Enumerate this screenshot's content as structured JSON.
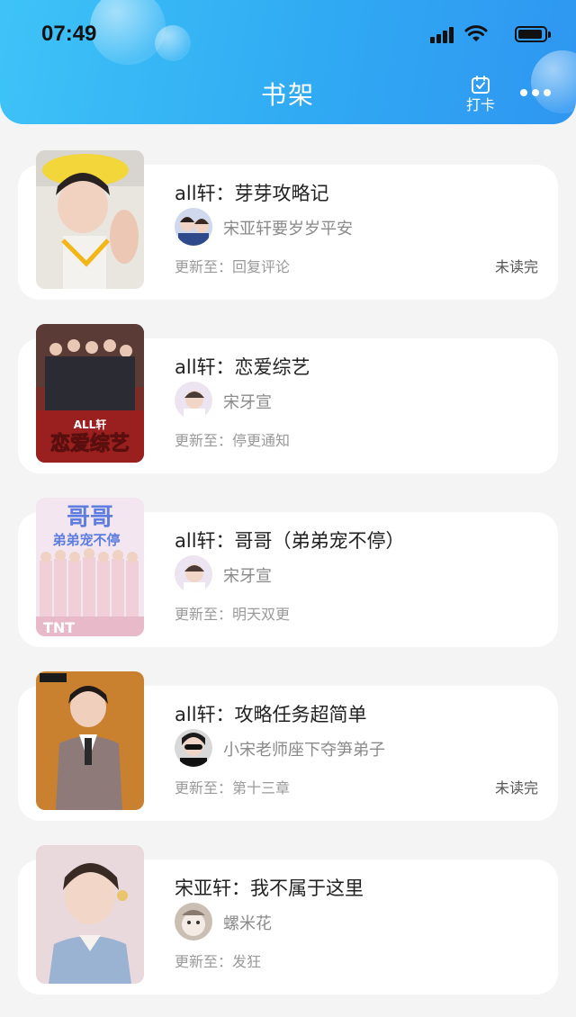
{
  "status_bar": {
    "time": "07:49"
  },
  "header": {
    "title": "书架",
    "checkin_label": "打卡"
  },
  "books": [
    {
      "title": "all轩：芽芽攻略记",
      "author": "宋亚轩要岁岁平安",
      "update": "更新至：回复评论",
      "badge": "未读完"
    },
    {
      "title": "all轩：恋爱综艺",
      "author": "宋牙宣",
      "update": "更新至：停更通知",
      "badge": ""
    },
    {
      "title": "all轩：哥哥（弟弟宠不停）",
      "author": "宋牙宣",
      "update": "更新至：明天双更",
      "badge": ""
    },
    {
      "title": "all轩：攻略任务超简单",
      "author": "小宋老师座下夺笋弟子",
      "update": "更新至：第十三章",
      "badge": "未读完"
    },
    {
      "title": "宋亚轩：我不属于这里",
      "author": "螺米花",
      "update": "更新至：发狂",
      "badge": ""
    }
  ],
  "covers": {
    "book2_text": "ALL轩 恋爱综艺",
    "book3_text": "哥哥 弟弟宠不停",
    "book3_footer": "TNT"
  },
  "colors": {
    "header_gradient_start": "#3ec3f7",
    "header_gradient_end": "#2f96f1",
    "background": "#f4f4f4",
    "card": "#ffffff"
  },
  "icons": [
    "signal-icon",
    "wifi-icon",
    "battery-icon",
    "calendar-check-icon",
    "more-icon"
  ]
}
